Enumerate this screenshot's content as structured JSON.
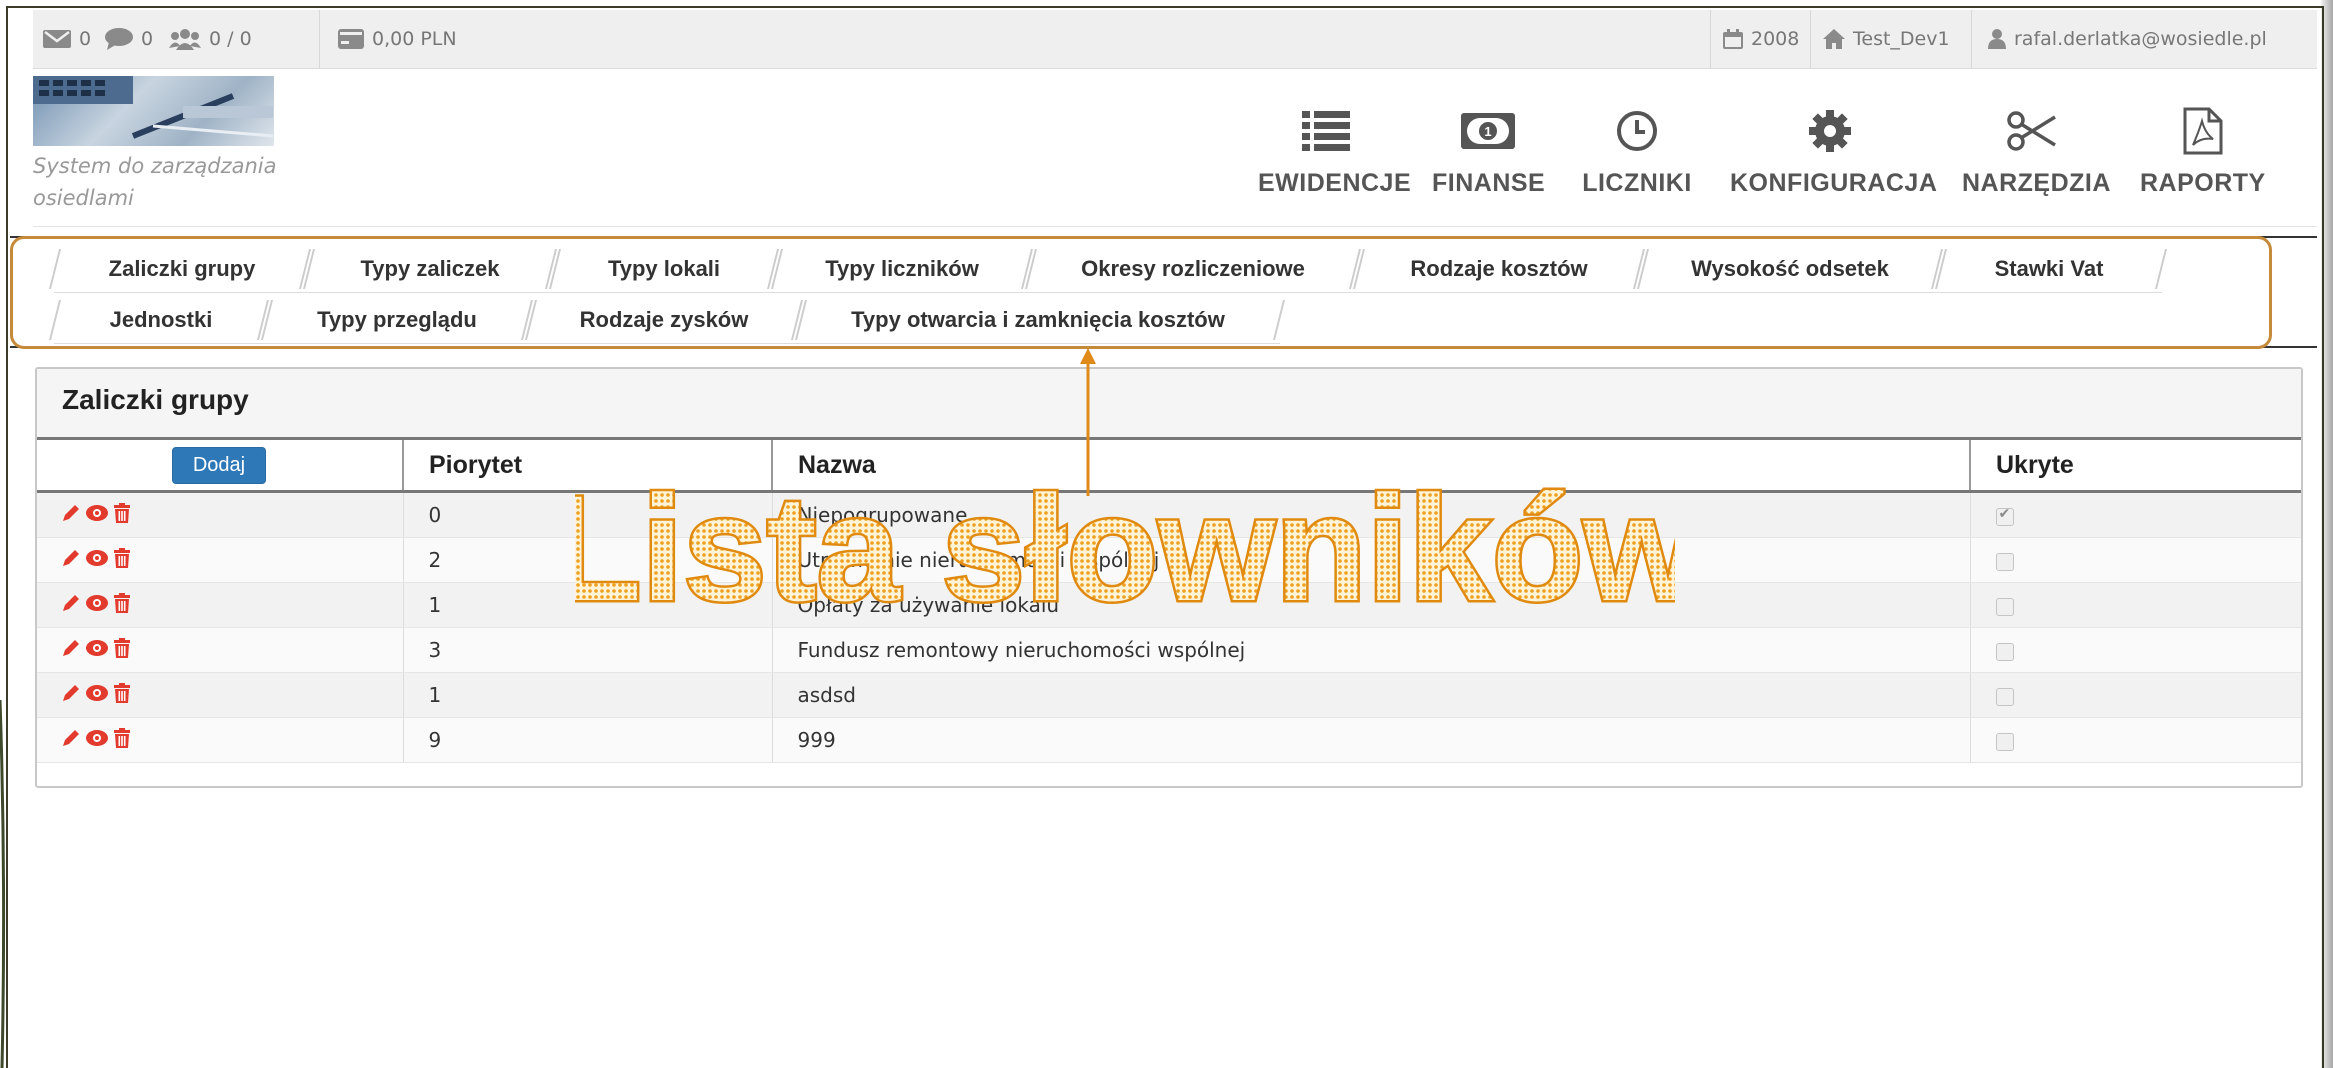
{
  "topbar": {
    "mail_count": "0",
    "chat_count": "0",
    "users_count": "0 / 0",
    "balance": "0,00 PLN",
    "year": "2008",
    "home_label": "Test_Dev1",
    "user_email": "rafal.derlatka@wosiedle.pl"
  },
  "header": {
    "tagline": "System do zarządzania osiedlami",
    "nav": [
      {
        "label": "EWIDENCJE",
        "icon": "list-icon"
      },
      {
        "label": "FINANSE",
        "icon": "money-icon"
      },
      {
        "label": "LICZNIKI",
        "icon": "clock-icon"
      },
      {
        "label": "KONFIGURACJA",
        "icon": "gear-icon"
      },
      {
        "label": "NARZĘDZIA",
        "icon": "scissors-icon"
      },
      {
        "label": "RAPORTY",
        "icon": "pdf-icon"
      }
    ]
  },
  "tabs": {
    "row1": [
      "Zaliczki grupy",
      "Typy zaliczek",
      "Typy lokali",
      "Typy liczników",
      "Okresy rozliczeniowe",
      "Rodzaje kosztów",
      "Wysokość odsetek",
      "Stawki Vat"
    ],
    "row2": [
      "Jednostki",
      "Typy przeglądu",
      "Rodzaje zysków",
      "Typy otwarcia i zamknięcia kosztów"
    ]
  },
  "panel": {
    "title": "Zaliczki grupy",
    "add_button": "Dodaj",
    "columns": [
      "Piorytet",
      "Nazwa",
      "Ukryte"
    ],
    "rows": [
      {
        "priority": "0",
        "name": "Niepogrupowane",
        "hidden": true
      },
      {
        "priority": "2",
        "name": "Utrzymanie nieruchomości wspólnej",
        "hidden": false
      },
      {
        "priority": "1",
        "name": "Opłaty za używanie lokalu",
        "hidden": false
      },
      {
        "priority": "3",
        "name": "Fundusz remontowy nieruchomości wspólnej",
        "hidden": false
      },
      {
        "priority": "1",
        "name": "asdsd",
        "hidden": false
      },
      {
        "priority": "9",
        "name": "999",
        "hidden": false
      }
    ]
  },
  "overlay": {
    "text": "Lista słowników",
    "color": "#f4a020"
  }
}
